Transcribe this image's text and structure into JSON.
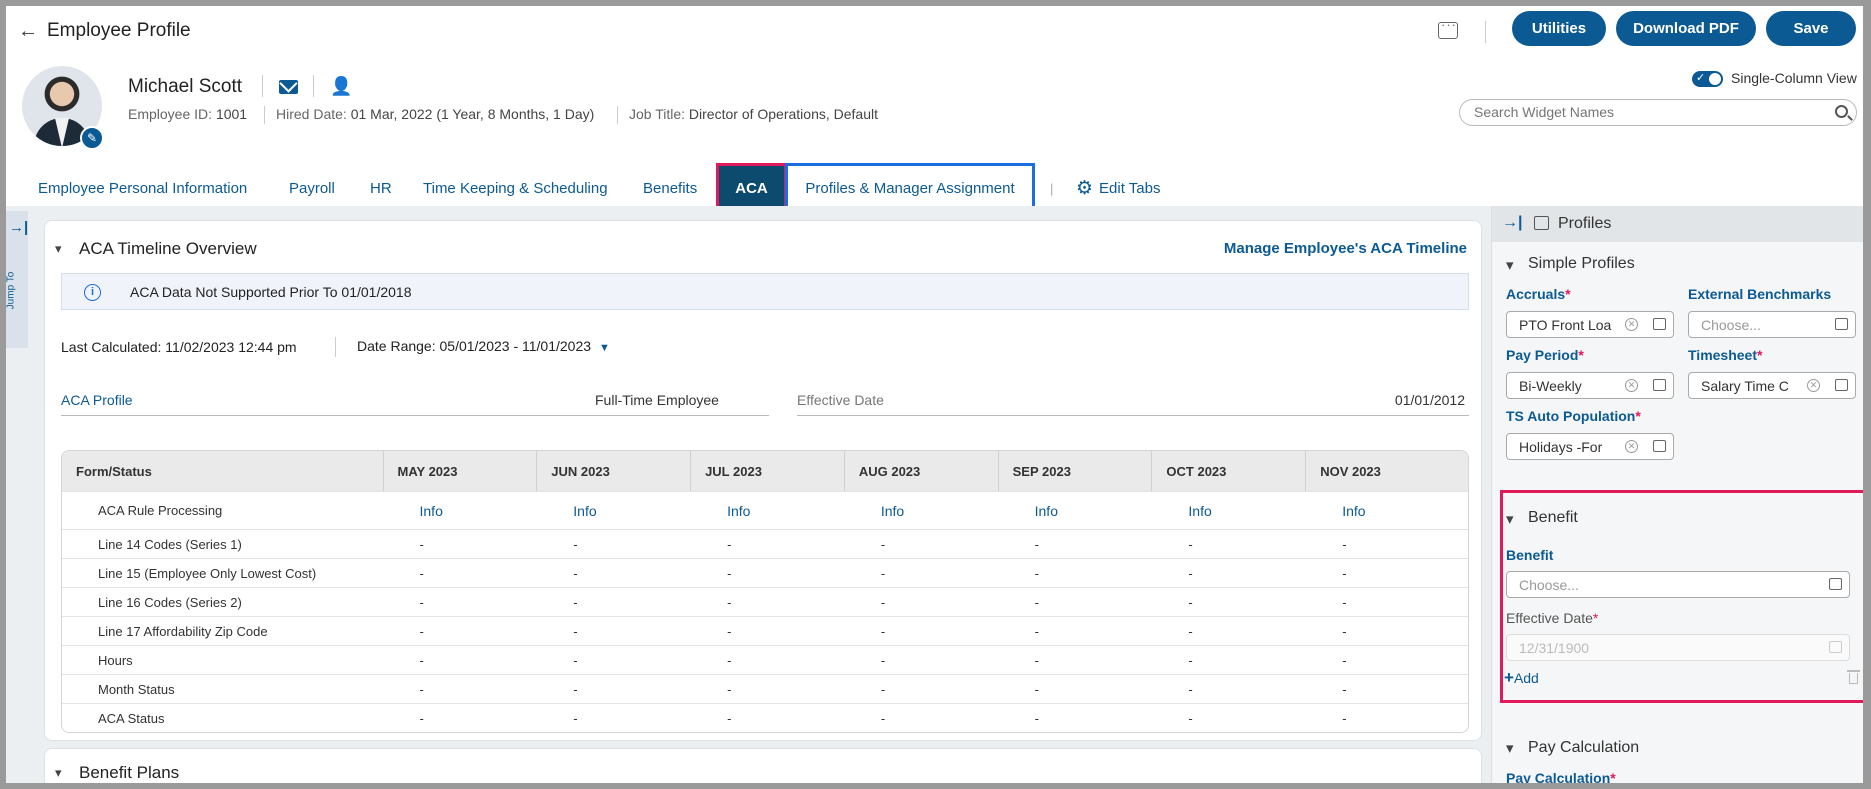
{
  "header": {
    "back_label": "←",
    "title": "Employee Profile",
    "utilities": "Utilities",
    "download_pdf": "Download PDF",
    "save": "Save"
  },
  "employee": {
    "name": "Michael Scott",
    "id_label": "Employee ID:",
    "id": "1001",
    "hired_label": "Hired Date:",
    "hired": "01 Mar, 2022 (1 Year, 8 Months, 1 Day)",
    "job_label": "Job Title:",
    "job": "Director of Operations, Default"
  },
  "view": {
    "single_column": "Single-Column View",
    "search_placeholder": "Search Widget Names"
  },
  "tabs": [
    {
      "label": "Employee Personal Information"
    },
    {
      "label": "Payroll"
    },
    {
      "label": "HR"
    },
    {
      "label": "Time Keeping & Scheduling"
    },
    {
      "label": "Benefits"
    },
    {
      "label": "ACA"
    },
    {
      "label": "Profiles & Manager Assignment"
    }
  ],
  "tab_separator": "|",
  "edit_tabs": "Edit Tabs",
  "jump_to": "Jump To",
  "aca": {
    "title": "ACA Timeline Overview",
    "manage_link": "Manage Employee's ACA Timeline",
    "notice": "ACA Data Not Supported Prior To 01/01/2018",
    "last_calculated": "Last Calculated: 11/02/2023 12:44 pm",
    "date_range": "Date Range: 05/01/2023 - 11/01/2023",
    "profile_label": "ACA Profile",
    "profile_value": "Full-Time Employee",
    "effective_label": "Effective Date",
    "effective_value": "01/01/2012",
    "table": {
      "headers": [
        "Form/Status",
        "MAY 2023",
        "JUN 2023",
        "JUL 2023",
        "AUG 2023",
        "SEP 2023",
        "OCT 2023",
        "NOV 2023"
      ],
      "rows": [
        {
          "label": "ACA Rule Processing",
          "cells": [
            "Info",
            "Info",
            "Info",
            "Info",
            "Info",
            "Info",
            "Info"
          ]
        },
        {
          "label": "Line 14 Codes (Series 1)",
          "cells": [
            "-",
            "-",
            "-",
            "-",
            "-",
            "-",
            "-"
          ]
        },
        {
          "label": "Line 15 (Employee Only Lowest Cost)",
          "cells": [
            "-",
            "-",
            "-",
            "-",
            "-",
            "-",
            "-"
          ]
        },
        {
          "label": "Line 16 Codes (Series 2)",
          "cells": [
            "-",
            "-",
            "-",
            "-",
            "-",
            "-",
            "-"
          ]
        },
        {
          "label": "Line 17 Affordability Zip Code",
          "cells": [
            "-",
            "-",
            "-",
            "-",
            "-",
            "-",
            "-"
          ]
        },
        {
          "label": "Hours",
          "cells": [
            "-",
            "-",
            "-",
            "-",
            "-",
            "-",
            "-"
          ]
        },
        {
          "label": "Month Status",
          "cells": [
            "-",
            "-",
            "-",
            "-",
            "-",
            "-",
            "-"
          ]
        },
        {
          "label": "ACA Status",
          "cells": [
            "-",
            "-",
            "-",
            "-",
            "-",
            "-",
            "-"
          ]
        }
      ]
    }
  },
  "benefit_plans_title": "Benefit Plans",
  "panel": {
    "title": "Profiles",
    "simple_profiles": "Simple Profiles",
    "accruals_label": "Accruals",
    "accruals_value": "PTO Front Loa",
    "external_label": "External Benchmarks",
    "external_placeholder": "Choose...",
    "pay_period_label": "Pay Period",
    "pay_period_value": "Bi-Weekly",
    "timesheet_label": "Timesheet",
    "timesheet_value": "Salary Time C",
    "ts_auto_label": "TS Auto Population",
    "ts_auto_value": "Holidays -For",
    "benefit_section": "Benefit",
    "benefit_label": "Benefit",
    "benefit_placeholder": "Choose...",
    "effective_label": "Effective Date",
    "effective_placeholder": "12/31/1900",
    "add_label": "Add",
    "pay_calc_section": "Pay Calculation",
    "pay_calc_label": "Pay Calculation",
    "required_mark": "*"
  },
  "colors": {
    "primary": "#0c5a94",
    "active_tab": "#0c4a6e",
    "highlight_red": "#e0195b",
    "highlight_blue": "#1a6ee0"
  }
}
